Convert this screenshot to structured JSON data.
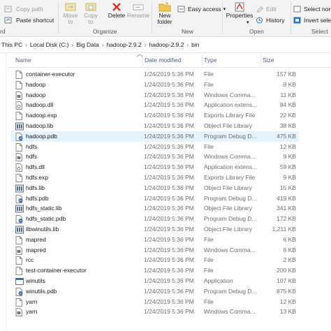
{
  "ribbon": {
    "copy_path": "Copy path",
    "paste_shortcut": "Paste shortcut",
    "move_to": "Move\nto",
    "copy_to": "Copy\nto",
    "delete": "Delete",
    "rename": "Rename",
    "new_folder": "New\nfolder",
    "easy_access": "Easy access",
    "properties": "Properties",
    "edit": "Edit",
    "history": "History",
    "select_none": "Select none",
    "invert_selection": "Invert select",
    "groups": {
      "clipboard_tail": "rd",
      "organize": "Organize",
      "new": "New",
      "open": "Open",
      "select": "Select"
    }
  },
  "address": {
    "crumbs": [
      "This PC",
      "Local Disk (C:)",
      "Big Data",
      "hadoop-2.9.2",
      "hadoop-2.9.2",
      "bin"
    ]
  },
  "columns": {
    "name": "Name",
    "date": "Date modified",
    "type": "Type",
    "size": "Size"
  },
  "files": [
    {
      "name": "container-executor",
      "date": "1/24/2019 5:36 PM",
      "type": "File",
      "size": "157 KB",
      "icon": "file-icon"
    },
    {
      "name": "hadoop",
      "date": "1/24/2019 5:36 PM",
      "type": "File",
      "size": "9 KB",
      "icon": "file-icon"
    },
    {
      "name": "hadoop",
      "date": "1/24/2019 5:36 PM",
      "type": "Windows Comma...",
      "size": "11 KB",
      "icon": "batch-file-icon"
    },
    {
      "name": "hadoop.dll",
      "date": "1/24/2019 5:36 PM",
      "type": "Application extens...",
      "size": "84 KB",
      "icon": "dll-file-icon"
    },
    {
      "name": "hadoop.exp",
      "date": "1/24/2019 5:36 PM",
      "type": "Exports Library File",
      "size": "22 KB",
      "icon": "file-icon"
    },
    {
      "name": "hadoop.lib",
      "date": "1/24/2019 5:36 PM",
      "type": "Object File Library",
      "size": "38 KB",
      "icon": "library-file-icon"
    },
    {
      "name": "hadoop.pdb",
      "date": "1/24/2019 5:36 PM",
      "type": "Program Debug D...",
      "size": "475 KB",
      "icon": "debug-file-icon"
    },
    {
      "name": "hdfs",
      "date": "1/24/2019 5:36 PM",
      "type": "File",
      "size": "12 KB",
      "icon": "file-icon"
    },
    {
      "name": "hdfs",
      "date": "1/24/2019 5:36 PM",
      "type": "Windows Comma...",
      "size": "9 KB",
      "icon": "batch-file-icon"
    },
    {
      "name": "hdfs.dll",
      "date": "1/24/2019 5:36 PM",
      "type": "Application extens...",
      "size": "59 KB",
      "icon": "dll-file-icon"
    },
    {
      "name": "hdfs.exp",
      "date": "1/24/2019 5:36 PM",
      "type": "Exports Library File",
      "size": "9 KB",
      "icon": "file-icon"
    },
    {
      "name": "hdfs.lib",
      "date": "1/24/2019 5:36 PM",
      "type": "Object File Library",
      "size": "15 KB",
      "icon": "library-file-icon"
    },
    {
      "name": "hdfs.pdb",
      "date": "1/24/2019 5:36 PM",
      "type": "Program Debug D...",
      "size": "419 KB",
      "icon": "debug-file-icon"
    },
    {
      "name": "hdfs_static.lib",
      "date": "1/24/2019 5:36 PM",
      "type": "Object File Library",
      "size": "341 KB",
      "icon": "library-file-icon"
    },
    {
      "name": "hdfs_static.pdb",
      "date": "1/24/2019 5:36 PM",
      "type": "Program Debug D...",
      "size": "172 KB",
      "icon": "debug-file-icon"
    },
    {
      "name": "libwinutils.lib",
      "date": "1/24/2019 5:36 PM",
      "type": "Object File Library",
      "size": "1,211 KB",
      "icon": "library-file-icon"
    },
    {
      "name": "mapred",
      "date": "1/24/2019 5:36 PM",
      "type": "File",
      "size": "6 KB",
      "icon": "file-icon"
    },
    {
      "name": "mapred",
      "date": "1/24/2019 5:36 PM",
      "type": "Windows Comma...",
      "size": "6 KB",
      "icon": "batch-file-icon"
    },
    {
      "name": "rcc",
      "date": "1/24/2019 5:36 PM",
      "type": "File",
      "size": "2 KB",
      "icon": "file-icon"
    },
    {
      "name": "test-container-executor",
      "date": "1/24/2019 5:36 PM",
      "type": "File",
      "size": "200 KB",
      "icon": "file-icon"
    },
    {
      "name": "winutils",
      "date": "1/24/2019 5:36 PM",
      "type": "Application",
      "size": "107 KB",
      "icon": "exe-icon"
    },
    {
      "name": "winutils.pdb",
      "date": "1/24/2019 5:36 PM",
      "type": "Program Debug D...",
      "size": "875 KB",
      "icon": "debug-file-icon"
    },
    {
      "name": "yarn",
      "date": "1/24/2019 5:36 PM",
      "type": "File",
      "size": "12 KB",
      "icon": "file-icon"
    },
    {
      "name": "yarn",
      "date": "1/24/2019 5:36 PM",
      "type": "Windows Comma...",
      "size": "13 KB",
      "icon": "batch-file-icon"
    }
  ],
  "selected_index": 6,
  "colors": {
    "selection": "#e5f3ff",
    "header_text": "#4c607a",
    "muted_text": "#6d6d6d",
    "ribbon_bg": "#f3f3f3",
    "delete_red": "#d9342b",
    "folder_yellow": "#f3c44f"
  }
}
